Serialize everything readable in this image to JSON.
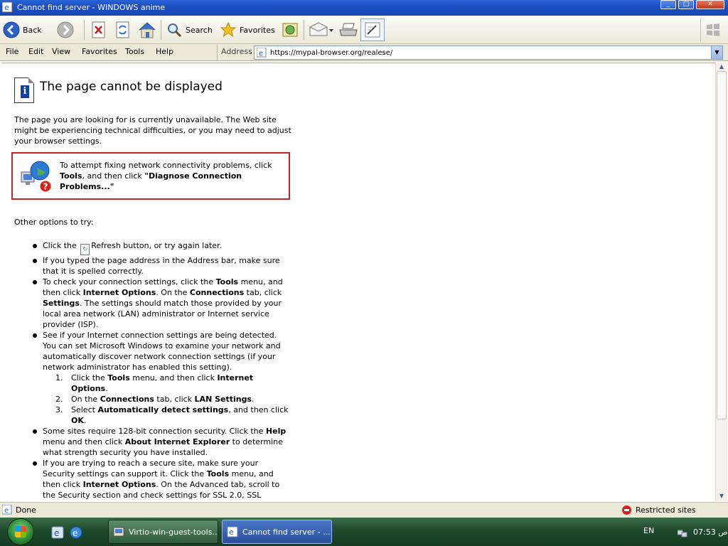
{
  "window": {
    "title": "Cannot find server - WINDOWS anime"
  },
  "toolbar": {
    "back_label": "Back",
    "search_label": "Search",
    "favorites_label": "Favorites"
  },
  "menu": {
    "items": [
      "File",
      "Edit",
      "View",
      "Favorites",
      "Tools",
      "Help"
    ]
  },
  "address": {
    "label": "Address",
    "value": "https://mypal-browser.org/realese/"
  },
  "page": {
    "title": "The page cannot be displayed",
    "intro": "The page you are looking for is currently unavailable. The Web site might be experiencing technical difficulties, or you may need to adjust your browser settings.",
    "diagnose": {
      "prefix": "To attempt fixing network connectivity problems, click ",
      "tools": "Tools",
      "middle": ", and then click ",
      "action": "\"Diagnose Connection Problems...\""
    },
    "other_options": "Other options to try:",
    "options": {
      "refresh_a": "Click the",
      "refresh_b": "Refresh button, or try again later.",
      "address_check": "If you typed the page address in the Address bar, make sure that it is spelled correctly.",
      "conn_a": "To check your connection settings, click the ",
      "conn_tools": "Tools",
      "conn_b": " menu, and then click ",
      "conn_io": "Internet Options",
      "conn_c": ". On the ",
      "conn_tab": "Connections",
      "conn_d": " tab, click ",
      "conn_settings": "Settings",
      "conn_e": ". The settings should match those provided by your local area network (LAN) administrator or Internet service provider (ISP).",
      "detect_a": "See if your Internet connection settings are being detected. You can set Microsoft Windows to examine your network and automatically discover network connection settings (if your network administrator has enabled this setting).",
      "step1_a": "Click the ",
      "step1_tools": "Tools",
      "step1_b": " menu, and then click ",
      "step1_io": "Internet Options",
      "step1_c": ".",
      "step2_a": "On the ",
      "step2_tab": "Connections",
      "step2_b": " tab, click ",
      "step2_lan": "LAN Settings",
      "step2_c": ".",
      "step3_a": "Select ",
      "step3_auto": "Automatically detect settings",
      "step3_b": ", and then click ",
      "step3_ok": "OK",
      "step3_c": ".",
      "sec_a": "Some sites require 128-bit connection security. Click the ",
      "sec_help": "Help",
      "sec_b": " menu and then click ",
      "sec_about": "About Internet Explorer",
      "sec_c": " to determine what strength security you have installed.",
      "ssl_a": "If you are trying to reach a secure site, make sure your Security settings can support it. Click the ",
      "ssl_tools": "Tools",
      "ssl_b": " menu, and then click ",
      "ssl_io": "Internet Options",
      "ssl_c": ". On the Advanced tab, scroll to the Security section and check settings for SSL 2.0, SSL"
    },
    "step_numbers": [
      "1.",
      "2.",
      "3."
    ]
  },
  "status": {
    "text": "Done",
    "zone": "Restricted sites"
  },
  "taskbar": {
    "task1": "Virtio-win-guest-tools...",
    "task2": "Cannot find server - ...",
    "lang": "EN",
    "clock": "07:53 ص"
  },
  "colors": {
    "titlebar": "#1c4fc1",
    "diagnose_border": "#c42424",
    "taskbar": "#1f4a2c",
    "restricted_icon": "#d8201c"
  }
}
